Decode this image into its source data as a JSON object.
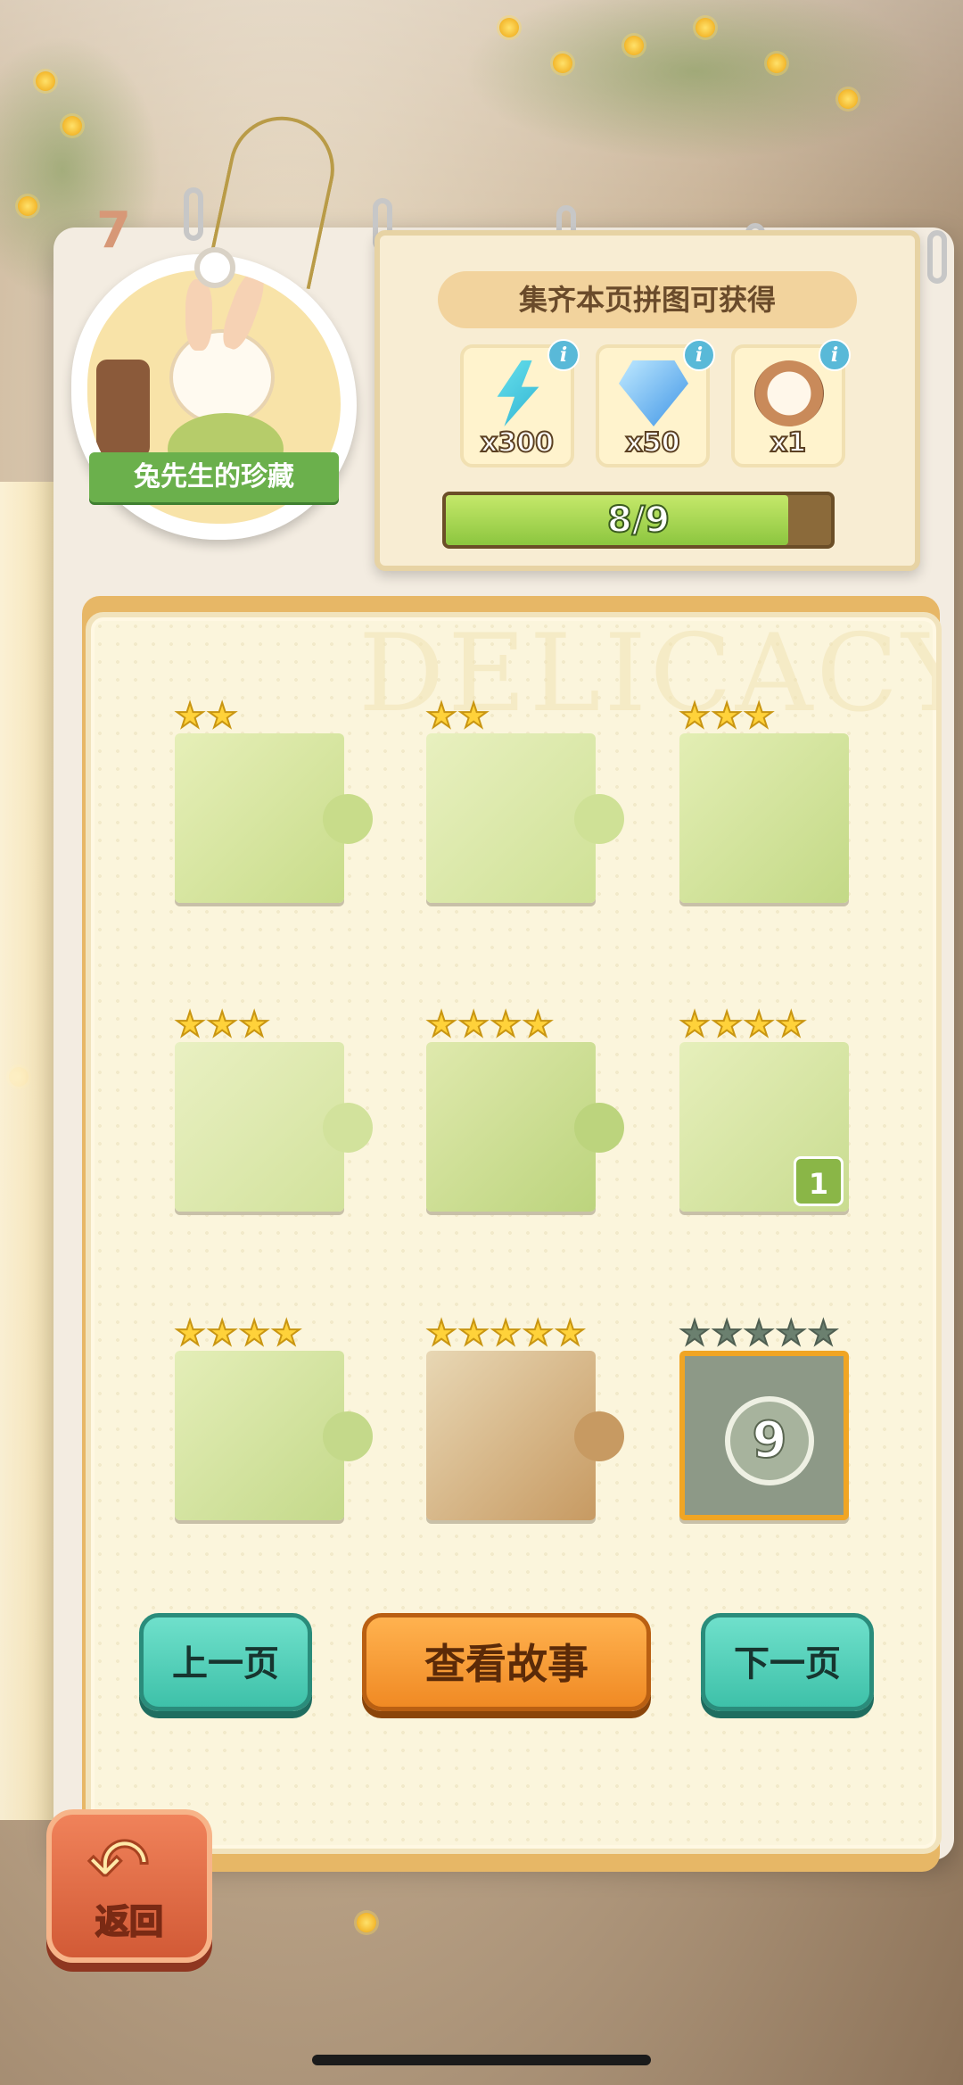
{
  "level": {
    "number": "7",
    "tag_title": "兔先生的珍藏"
  },
  "reward_panel": {
    "title": "集齐本页拼图可获得",
    "items": [
      {
        "icon": "lightning-icon",
        "count": "x300",
        "color": "#3fc9d6"
      },
      {
        "icon": "diamond-icon",
        "count": "x50",
        "color": "#5fb7f0"
      },
      {
        "icon": "stopwatch-icon",
        "count": "x1",
        "color": "#c98a5a"
      }
    ],
    "progress": {
      "text": "8/9",
      "current": 8,
      "total": 9,
      "fraction": 0.8889
    }
  },
  "watermark": "DELICACY",
  "pieces": [
    {
      "stars": 2,
      "max_stars": 2,
      "locked": false
    },
    {
      "stars": 2,
      "max_stars": 2,
      "locked": false
    },
    {
      "stars": 3,
      "max_stars": 3,
      "locked": false
    },
    {
      "stars": 3,
      "max_stars": 3,
      "locked": false
    },
    {
      "stars": 4,
      "max_stars": 4,
      "locked": false
    },
    {
      "stars": 4,
      "max_stars": 4,
      "locked": false,
      "badge": "1"
    },
    {
      "stars": 4,
      "max_stars": 4,
      "locked": false
    },
    {
      "stars": 5,
      "max_stars": 5,
      "locked": false
    },
    {
      "stars": 0,
      "max_stars": 5,
      "locked": true,
      "number": "9"
    }
  ],
  "buttons": {
    "prev": "上一页",
    "story": "查看故事",
    "next": "下一页",
    "back": "返回"
  },
  "colors": {
    "accent_green": "#8cc63f",
    "teal": "#3ec1a9",
    "orange": "#f08a24",
    "star": "#ffd23a"
  }
}
